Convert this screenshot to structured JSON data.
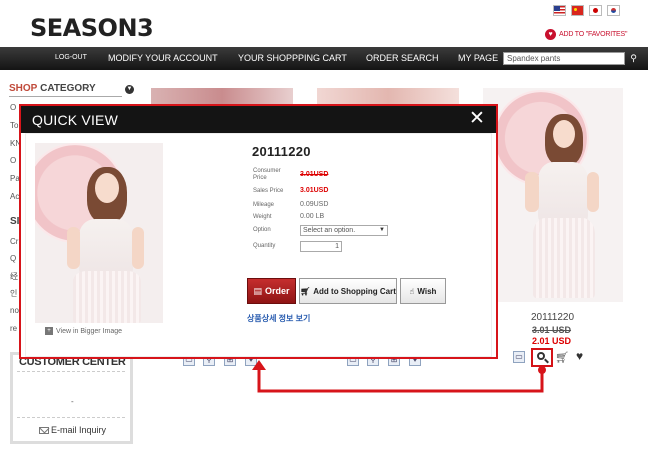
{
  "header": {
    "logo": "SEASON3",
    "favorites_label": "ADD TO \"FAVORITES\""
  },
  "flags": [
    "us-flag-icon",
    "china-flag-icon",
    "japan-flag-icon",
    "korea-flag-icon"
  ],
  "nav": {
    "logout": "LOG-OUT",
    "items": [
      "MODIFY YOUR ACCOUNT",
      "YOUR SHOPPPING CART",
      "ORDER SEARCH",
      "MY PAGE"
    ],
    "search_value": "Spandex pants"
  },
  "sidebar": {
    "category_prefix": "SHOP",
    "category_title": "CATEGORY",
    "peek_items": [
      "O",
      "To",
      "KN",
      "O",
      "Pa",
      "Ac"
    ],
    "section2_peek": "SI",
    "section2_items": [
      "Cr",
      "Q",
      "经",
      "인",
      "no",
      "re"
    ],
    "customer_center": {
      "title": "CUSTOMER CENTER",
      "dot": "-",
      "email_label": "E-mail Inquiry"
    }
  },
  "right_product": {
    "name": "20111220",
    "old_price": "3.01 USD",
    "new_price": "2.01 USD"
  },
  "quick_view": {
    "title": "QUICK VIEW",
    "bigger_label": "View in Bigger Image",
    "product_name": "20111220",
    "fields": {
      "consumer_price_label": "Consumer Price",
      "consumer_price": "3.01USD",
      "sales_price_label": "Sales Price",
      "sales_price": "3.01USD",
      "mileage_label": "Mileage",
      "mileage": "0.09USD",
      "weight_label": "Weight",
      "weight": "0.00 LB",
      "option_label": "Option",
      "option_placeholder": "Select an option.",
      "quantity_label": "Quantity",
      "quantity": "1"
    },
    "buttons": {
      "order": "Order",
      "add_to_cart": "Add to Shopping Cart",
      "wish": "Wish"
    },
    "detail_link": "상품상세 정보 보기"
  },
  "colors": {
    "accent_red": "#d7141a",
    "nav_bg": "#141414",
    "price_red": "#dd0000",
    "link_blue": "#2a5db0"
  }
}
